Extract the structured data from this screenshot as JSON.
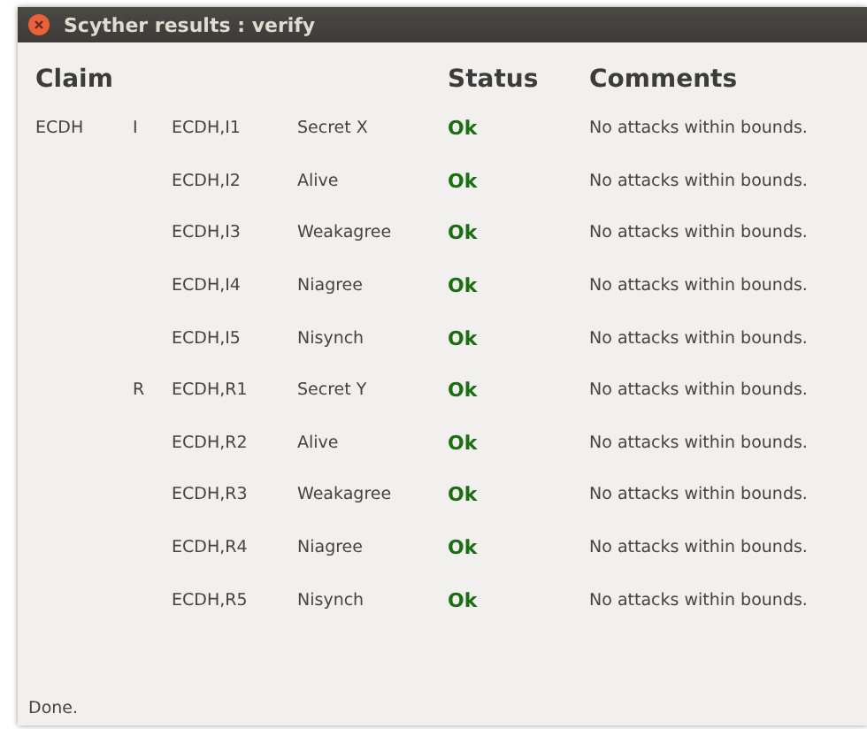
{
  "window": {
    "title": "Scyther results : verify"
  },
  "table": {
    "columns": [
      "Claim",
      "Status",
      "Comments"
    ],
    "rows": [
      {
        "protocol": "ECDH",
        "role": "I",
        "id": "ECDH,I1",
        "claim": "Secret X",
        "status": "Ok",
        "comment": "No attacks within bounds."
      },
      {
        "id": "ECDH,I2",
        "claim": "Alive",
        "status": "Ok",
        "comment": "No attacks within bounds."
      },
      {
        "id": "ECDH,I3",
        "claim": "Weakagree",
        "status": "Ok",
        "comment": "No attacks within bounds."
      },
      {
        "id": "ECDH,I4",
        "claim": "Niagree",
        "status": "Ok",
        "comment": "No attacks within bounds."
      },
      {
        "id": "ECDH,I5",
        "claim": "Nisynch",
        "status": "Ok",
        "comment": "No attacks within bounds."
      },
      {
        "role": "R",
        "id": "ECDH,R1",
        "claim": "Secret Y",
        "status": "Ok",
        "comment": "No attacks within bounds."
      },
      {
        "id": "ECDH,R2",
        "claim": "Alive",
        "status": "Ok",
        "comment": "No attacks within bounds."
      },
      {
        "id": "ECDH,R3",
        "claim": "Weakagree",
        "status": "Ok",
        "comment": "No attacks within bounds."
      },
      {
        "id": "ECDH,R4",
        "claim": "Niagree",
        "status": "Ok",
        "comment": "No attacks within bounds."
      },
      {
        "id": "ECDH,R5",
        "claim": "Nisynch",
        "status": "Ok",
        "comment": "No attacks within bounds."
      }
    ]
  },
  "status_bar": "Done."
}
